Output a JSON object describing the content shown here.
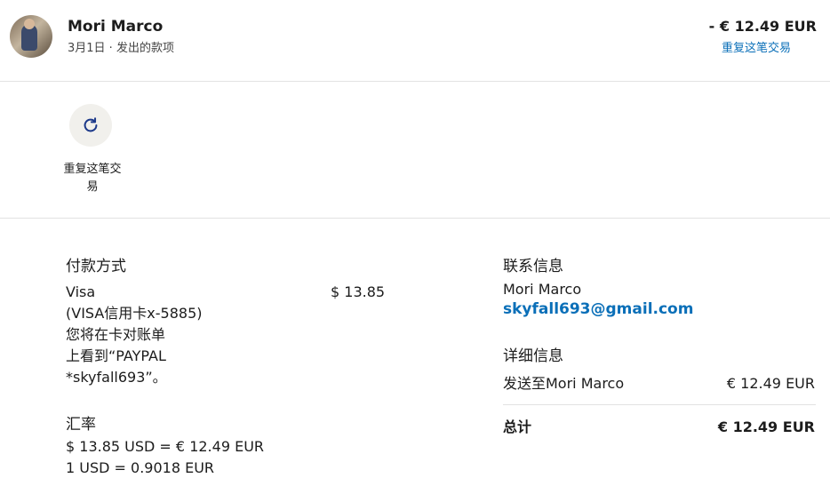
{
  "header": {
    "name": "Mori Marco",
    "date_line": "3月1日 · 发出的款项",
    "amount": "- € 12.49 EUR",
    "repeat_link": "重复这笔交易"
  },
  "actions": {
    "repeat_label": "重复这笔交易"
  },
  "payment": {
    "title": "付款方式",
    "method": "Visa",
    "card": "(VISA信用卡x-5885)",
    "note_lines": [
      "您将在卡对账单",
      "上看到“PAYPAL",
      "*skyfall693”。"
    ],
    "amount": "$ 13.85"
  },
  "exchange": {
    "title": "汇率",
    "line1": "$ 13.85 USD = € 12.49 EUR",
    "line2": "1 USD = 0.9018 EUR"
  },
  "contact": {
    "title": "联系信息",
    "name": "Mori Marco",
    "email": "skyfall693@gmail.com"
  },
  "details": {
    "title": "详细信息",
    "sent_label": "发送至Mori Marco",
    "sent_value": "€ 12.49 EUR",
    "total_label": "总计",
    "total_value": "€ 12.49 EUR"
  },
  "colors": {
    "link": "#0a6fb8",
    "icon": "#1d3a8a"
  }
}
